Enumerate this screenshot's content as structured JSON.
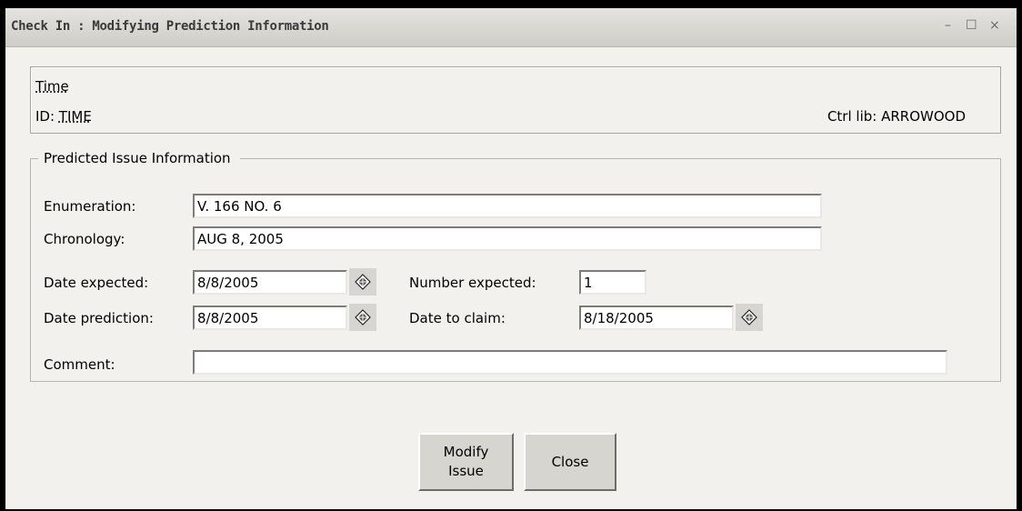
{
  "window": {
    "title": "Check In : Modifying Prediction Information",
    "controls": {
      "minimize": "–",
      "maximize": "☐",
      "close": "×"
    }
  },
  "header": {
    "title": "Time",
    "id_label": "ID: ",
    "id_value": "TIME",
    "ctrl_lib": "Ctrl lib: ARROWOOD"
  },
  "form": {
    "legend": "Predicted Issue Information",
    "enumeration": {
      "label": "Enumeration:",
      "value": "V. 166 NO. 6"
    },
    "chronology": {
      "label": "Chronology:",
      "value": "AUG 8, 2005"
    },
    "date_expected": {
      "label": "Date expected:",
      "value": "8/8/2005"
    },
    "number_expected": {
      "label": "Number expected:",
      "value": "1"
    },
    "date_prediction": {
      "label": "Date prediction:",
      "value": "8/8/2005"
    },
    "date_to_claim": {
      "label": "Date to claim:",
      "value": "8/18/2005"
    },
    "comment": {
      "label": "Comment:",
      "value": ""
    }
  },
  "buttons": {
    "modify_line1": "Modify",
    "modify_line2": "Issue",
    "close": "Close"
  },
  "icons": {
    "calendar": "calendar-icon"
  }
}
